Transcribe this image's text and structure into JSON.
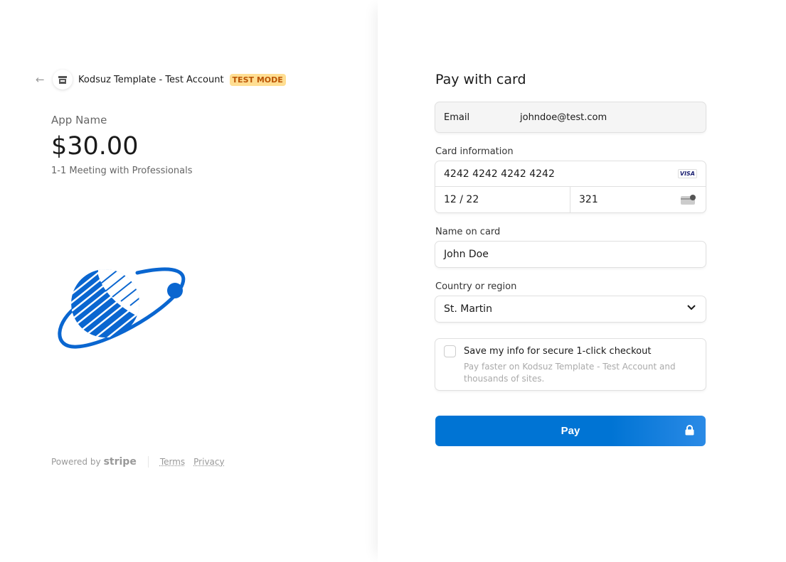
{
  "merchant": {
    "back_icon": "arrow-left-icon",
    "store_icon": "store-icon",
    "account_name": "Kodsuz Template - Test Account",
    "badge": "TEST MODE"
  },
  "product": {
    "name": "App Name",
    "price": "$30.00",
    "description": "1-1 Meeting with Professionals"
  },
  "footer": {
    "powered_by": "Powered by",
    "brand": "stripe",
    "terms": "Terms",
    "privacy": "Privacy"
  },
  "form": {
    "title": "Pay with card",
    "email": {
      "label": "Email",
      "value": "johndoe@test.com"
    },
    "card": {
      "label": "Card information",
      "number": "4242 4242 4242 4242",
      "brand": "VISA",
      "expiry": "12 / 22",
      "cvc": "321"
    },
    "name": {
      "label": "Name on card",
      "value": "John Doe"
    },
    "country": {
      "label": "Country or region",
      "value": "St. Martin"
    },
    "save": {
      "title": "Save my info for secure 1-click checkout",
      "subtitle": "Pay faster on Kodsuz Template - Test Account and thousands of sites.",
      "checked": false
    },
    "pay_label": "Pay"
  },
  "colors": {
    "accent": "#0074d4",
    "badge_bg": "#ffde92",
    "badge_text": "#bb5504"
  }
}
